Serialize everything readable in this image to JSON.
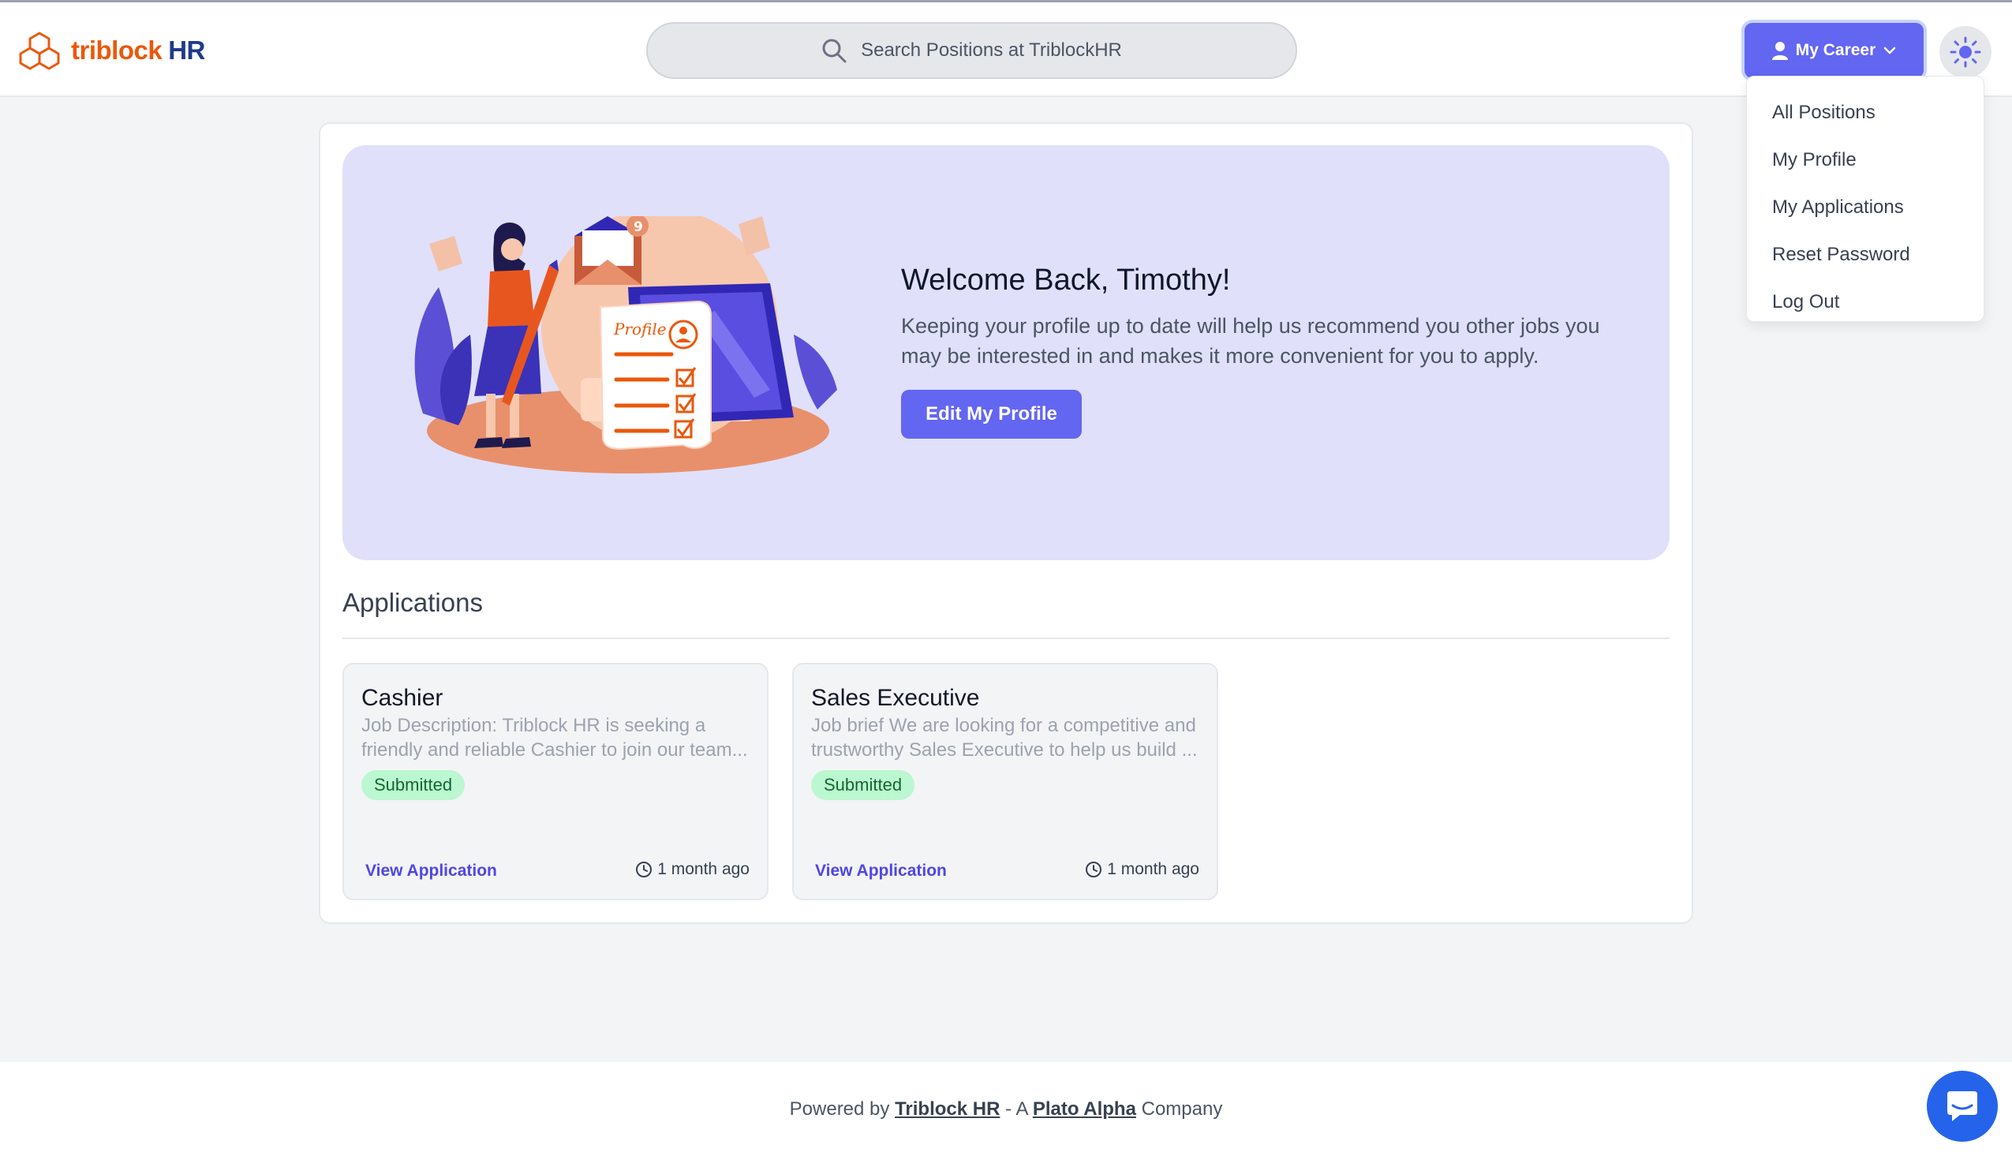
{
  "brand": {
    "name_part1": "triblock",
    "name_part2": "HR",
    "accent": "#ea580c",
    "secondary": "#1e3a8a"
  },
  "search": {
    "placeholder": "Search Positions at TriblockHR",
    "icon": "search-icon"
  },
  "nav": {
    "career_label": "My Career",
    "career_icon": "user-icon",
    "theme_icon": "sun-icon",
    "menu": [
      {
        "label": "All Positions"
      },
      {
        "label": "My Profile"
      },
      {
        "label": "My Applications"
      },
      {
        "label": "Reset Password"
      },
      {
        "label": "Log Out"
      }
    ]
  },
  "hero": {
    "illustration_label": "Profile",
    "notification_count": "9",
    "title": "Welcome Back, Timothy!",
    "text": "Keeping your profile up to date will help us recommend you other jobs you may be interested in and makes it more convenient for you to apply.",
    "button": "Edit My Profile"
  },
  "applications": {
    "heading": "Applications",
    "items": [
      {
        "title": "Cashier",
        "description": "Job Description: Triblock HR is seeking a friendly and reliable Cashier to join our team...",
        "status": "Submitted",
        "link": "View Application",
        "time": "1 month ago"
      },
      {
        "title": "Sales Executive",
        "description": "Job brief We are looking for a competitive and trustworthy Sales Executive to help us build ...",
        "status": "Submitted",
        "link": "View Application",
        "time": "1 month ago"
      }
    ]
  },
  "footer": {
    "prefix": "Powered by",
    "brand_link": "Triblock HR",
    "middle": "- A",
    "company_link": "Plato Alpha",
    "suffix": "Company"
  },
  "colors": {
    "primary": "#6366f1",
    "hero_bg": "#e0e0fb",
    "badge_bg": "#bbf7d0",
    "badge_text": "#166534",
    "chat": "#2563eb"
  }
}
